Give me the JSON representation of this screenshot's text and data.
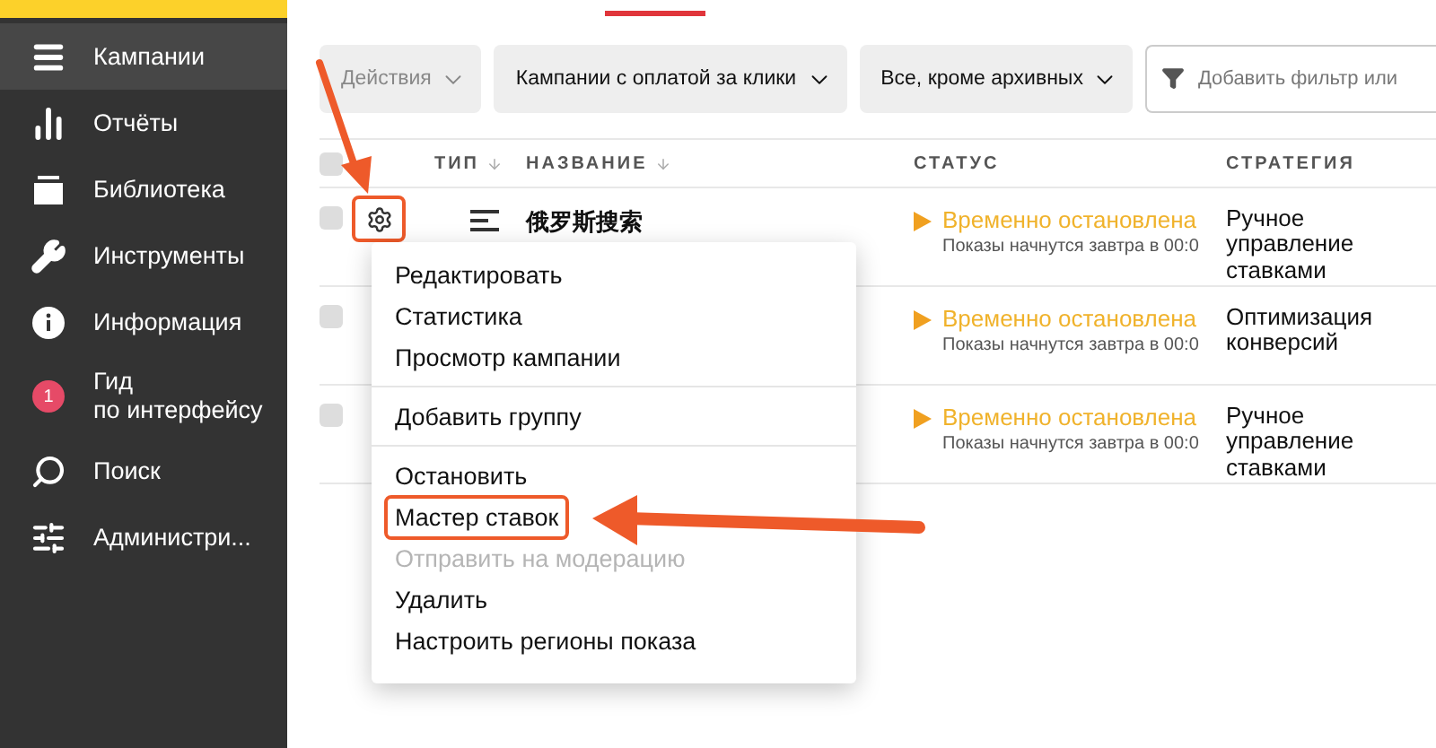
{
  "sidebar": {
    "items": [
      {
        "label": "Кампании",
        "selected": true
      },
      {
        "label": "Отчёты",
        "selected": false
      },
      {
        "label": "Библиотека",
        "selected": false
      },
      {
        "label": "Инструменты",
        "selected": false
      },
      {
        "label": "Информация",
        "selected": false
      },
      {
        "label": "Гид\nпо интерфейсу",
        "badge": "1",
        "selected": false
      },
      {
        "label": "Поиск",
        "selected": false
      },
      {
        "label": "Администри...",
        "selected": false
      }
    ]
  },
  "toolbar": {
    "buttons": [
      {
        "label": "Действия",
        "disabled": true
      },
      {
        "label": "Кампании с оплатой за клики",
        "disabled": false
      },
      {
        "label": "Все, кроме архивных",
        "disabled": false
      }
    ],
    "filter": {
      "placeholder": "Добавить фильтр или"
    }
  },
  "table": {
    "select_all_checked": false,
    "columns": [
      {
        "label": "ТИП",
        "sortable": true
      },
      {
        "label": "НАЗВАНИЕ",
        "sortable": true
      },
      {
        "label": "СТАТУС",
        "sortable": false
      },
      {
        "label": "СТРАТЕГИЯ",
        "sortable": false
      }
    ],
    "rows": [
      {
        "checked": false,
        "name": "俄罗斯搜索",
        "gear_highlighted": true,
        "status": "Временно остановлена",
        "status_note": "Показы начнутся завтра в 00:0",
        "strategy": "Ручное управление ставками"
      },
      {
        "checked": false,
        "status": "Временно остановлена",
        "status_note": "Показы начнутся завтра в 00:0",
        "strategy": "Оптимизация конверсий"
      },
      {
        "checked": false,
        "status": "Временно остановлена",
        "status_note": "Показы начнутся завтра в 00:0",
        "strategy": "Ручное управление ставками"
      }
    ]
  },
  "context_menu": {
    "groups": [
      [
        {
          "label": "Редактировать",
          "disabled": false,
          "highlighted": false
        },
        {
          "label": "Статистика",
          "disabled": false,
          "highlighted": false
        },
        {
          "label": "Просмотр кампании",
          "disabled": false,
          "highlighted": false
        }
      ],
      [
        {
          "label": "Добавить группу",
          "disabled": false,
          "highlighted": false
        }
      ],
      [
        {
          "label": "Остановить",
          "disabled": false,
          "highlighted": false
        },
        {
          "label": "Мастер ставок",
          "disabled": false,
          "highlighted": true
        },
        {
          "label": "Отправить на модерацию",
          "disabled": true,
          "highlighted": false
        },
        {
          "label": "Удалить",
          "disabled": false,
          "highlighted": false
        },
        {
          "label": "Настроить регионы показа",
          "disabled": false,
          "highlighted": false
        }
      ]
    ]
  }
}
